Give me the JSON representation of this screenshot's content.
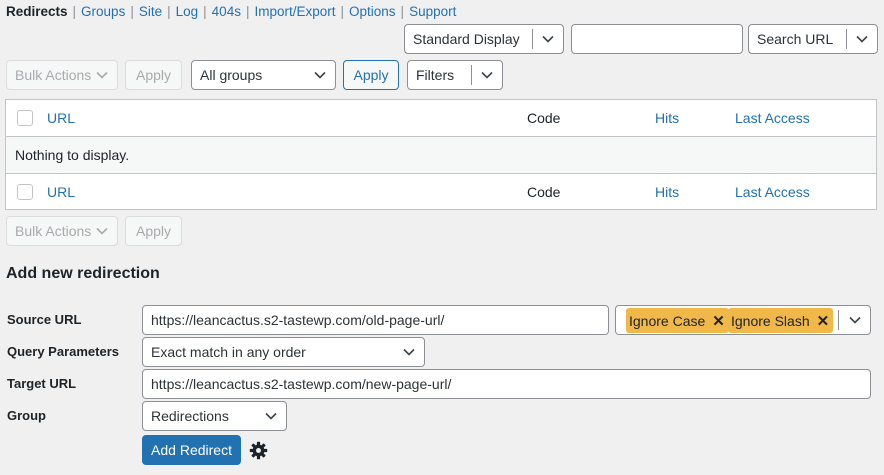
{
  "subnav": {
    "items": [
      {
        "label": "Redirects",
        "current": true
      },
      {
        "label": "Groups"
      },
      {
        "label": "Site"
      },
      {
        "label": "Log"
      },
      {
        "label": "404s"
      },
      {
        "label": "Import/Export"
      },
      {
        "label": "Options"
      },
      {
        "label": "Support"
      }
    ],
    "separator": "|"
  },
  "toolbar_top": {
    "display_select": "Standard Display",
    "search_value": "",
    "search_type": "Search URL"
  },
  "toolbar": {
    "bulk_actions": "Bulk Actions",
    "apply": "Apply",
    "group_select": "All groups",
    "group_apply": "Apply",
    "filters": "Filters"
  },
  "table": {
    "columns": {
      "url": "URL",
      "code": "Code",
      "hits": "Hits",
      "last_access": "Last Access"
    },
    "empty_message": "Nothing to display."
  },
  "toolbar_bottom": {
    "bulk_actions": "Bulk Actions",
    "apply": "Apply"
  },
  "form": {
    "heading": "Add new redirection",
    "source_label": "Source URL",
    "source_value": "https://leancactus.s2-tastewp.com/old-page-url/",
    "tags": [
      "Ignore Case",
      "Ignore Slash"
    ],
    "tag_remove": "✕",
    "query_label": "Query Parameters",
    "query_value": "Exact match in any order",
    "target_label": "Target URL",
    "target_value": "https://leancactus.s2-tastewp.com/new-page-url/",
    "group_label": "Group",
    "group_value": "Redirections",
    "submit": "Add Redirect"
  },
  "colors": {
    "accent": "#2271b1",
    "tag": "#f0b849",
    "background": "#f0f0f1"
  },
  "icons": {
    "chevron": "chevron-down-icon",
    "settings": "gear-icon"
  }
}
